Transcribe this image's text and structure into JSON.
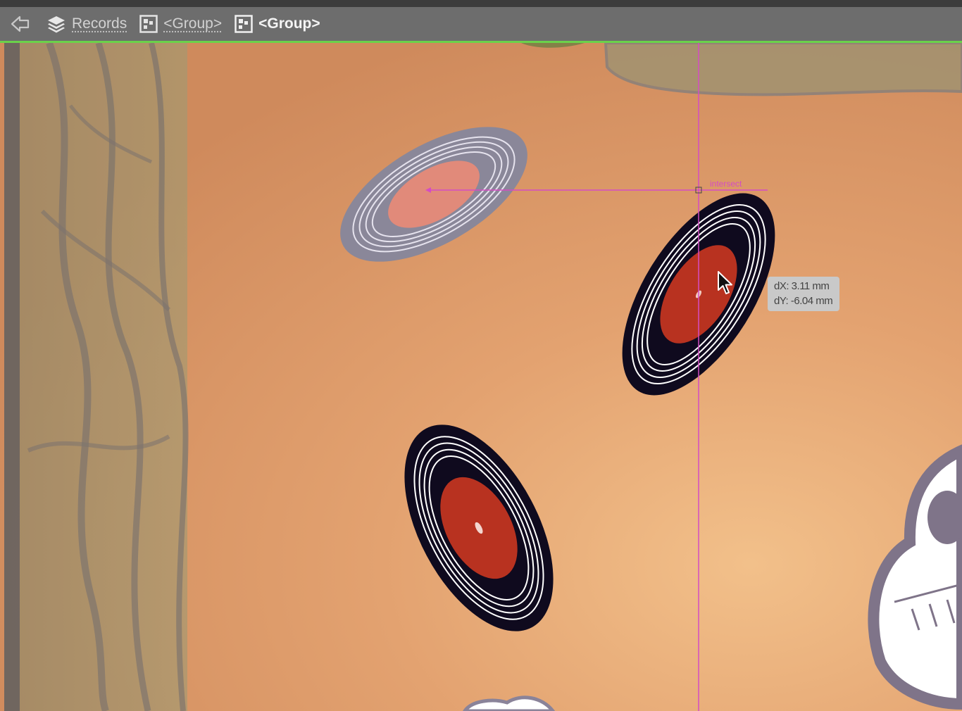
{
  "breadcrumb": {
    "back_icon": "back-arrow-icon",
    "items": [
      {
        "label": "Records",
        "icon": "layers-icon"
      },
      {
        "label": "<Group>",
        "icon": "group-icon"
      },
      {
        "label": "<Group>",
        "icon": "group-icon"
      }
    ]
  },
  "smart_guide": {
    "label": "intersect",
    "dx": "dX: 3.11 mm",
    "dy": "dY: -6.04 mm"
  },
  "colors": {
    "isolation_accent": "#6bd14a",
    "smart_guide": "#d44cc4",
    "record_vinyl": "#0f0a1e",
    "record_label": "#b83220",
    "background": "#e0a272"
  }
}
